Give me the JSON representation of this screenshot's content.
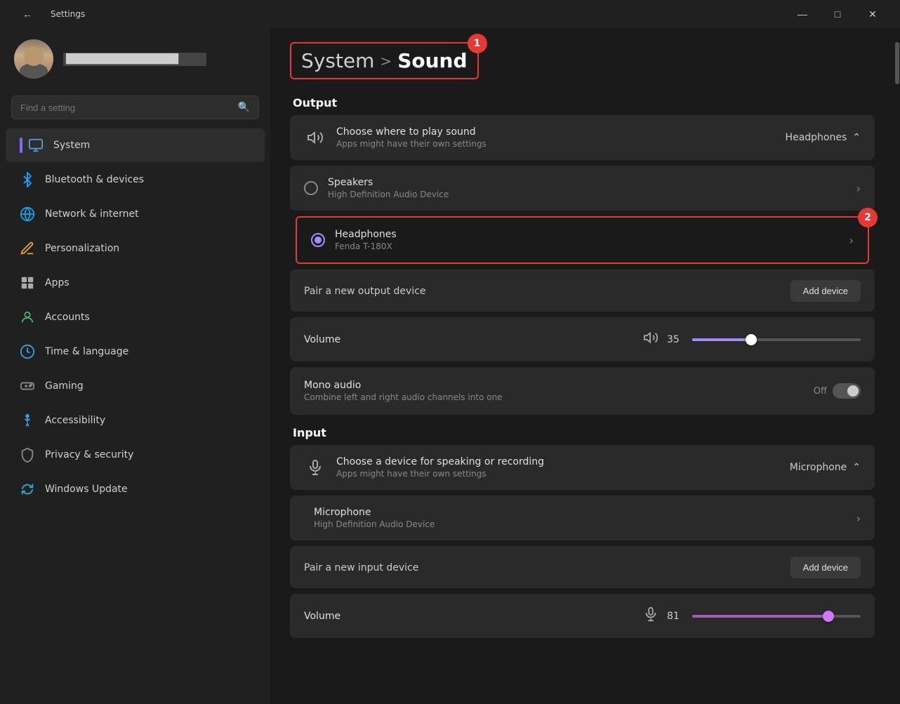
{
  "titlebar": {
    "title": "Settings",
    "minimize": "—",
    "maximize": "□",
    "close": "✕"
  },
  "sidebar": {
    "search_placeholder": "Find a setting",
    "nav_items": [
      {
        "id": "system",
        "label": "System",
        "icon": "🖥",
        "active": true,
        "icon_type": "system"
      },
      {
        "id": "bluetooth",
        "label": "Bluetooth & devices",
        "icon": "⬡",
        "icon_type": "bluetooth"
      },
      {
        "id": "network",
        "label": "Network & internet",
        "icon": "🌐",
        "icon_type": "network"
      },
      {
        "id": "personalization",
        "label": "Personalization",
        "icon": "✏",
        "icon_type": "personalization"
      },
      {
        "id": "apps",
        "label": "Apps",
        "icon": "⊞",
        "icon_type": "apps"
      },
      {
        "id": "accounts",
        "label": "Accounts",
        "icon": "👤",
        "icon_type": "accounts"
      },
      {
        "id": "time",
        "label": "Time & language",
        "icon": "🕐",
        "icon_type": "time"
      },
      {
        "id": "gaming",
        "label": "Gaming",
        "icon": "🎮",
        "icon_type": "gaming"
      },
      {
        "id": "accessibility",
        "label": "Accessibility",
        "icon": "♿",
        "icon_type": "accessibility"
      },
      {
        "id": "privacy",
        "label": "Privacy & security",
        "icon": "🛡",
        "icon_type": "privacy"
      },
      {
        "id": "update",
        "label": "Windows Update",
        "icon": "↻",
        "icon_type": "update"
      }
    ]
  },
  "main": {
    "breadcrumb": {
      "system_label": "System",
      "separator": ">",
      "current_label": "Sound",
      "badge1": "1"
    },
    "output": {
      "section_title": "Output",
      "choose_device": {
        "title": "Choose where to play sound",
        "subtitle": "Apps might have their own settings",
        "value": "Headphones",
        "expanded": true
      },
      "speakers": {
        "title": "Speakers",
        "subtitle": "High Definition Audio Device",
        "selected": false
      },
      "headphones": {
        "title": "Headphones",
        "subtitle": "Fenda T-180X",
        "selected": true,
        "badge2": "2"
      },
      "pair_new": "Pair a new output device",
      "add_device": "Add device",
      "volume": {
        "label": "Volume",
        "value": 35,
        "percent": 35
      },
      "mono_audio": {
        "title": "Mono audio",
        "subtitle": "Combine left and right audio channels into one",
        "state": "Off",
        "enabled": false
      }
    },
    "input": {
      "section_title": "Input",
      "choose_device": {
        "title": "Choose a device for speaking or recording",
        "subtitle": "Apps might have their own settings",
        "value": "Microphone",
        "expanded": true
      },
      "microphone": {
        "title": "Microphone",
        "subtitle": "High Definition Audio Device"
      },
      "pair_new": "Pair a new input device",
      "add_device": "Add device",
      "volume": {
        "label": "Volume",
        "value": 81,
        "percent": 81
      }
    }
  }
}
